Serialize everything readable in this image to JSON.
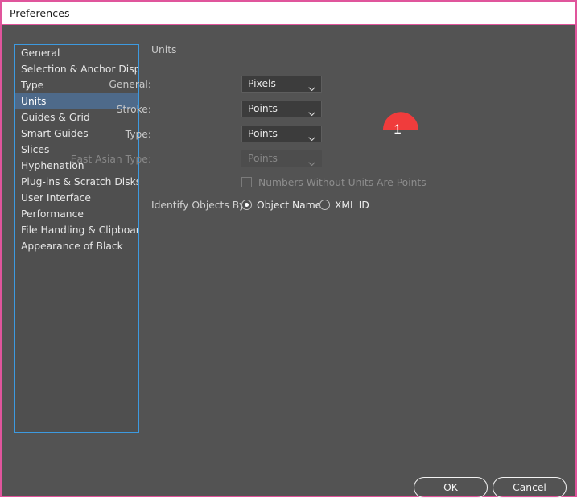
{
  "window": {
    "title": "Preferences",
    "border_color": "#e0559c",
    "background": "#535353"
  },
  "sidebar": {
    "accent_color": "#3d9ae0",
    "selected": "Units",
    "items": [
      {
        "label": "General"
      },
      {
        "label": "Selection & Anchor Display"
      },
      {
        "label": "Type"
      },
      {
        "label": "Units"
      },
      {
        "label": "Guides & Grid"
      },
      {
        "label": "Smart Guides"
      },
      {
        "label": "Slices"
      },
      {
        "label": "Hyphenation"
      },
      {
        "label": "Plug-ins & Scratch Disks"
      },
      {
        "label": "User Interface"
      },
      {
        "label": "Performance"
      },
      {
        "label": "File Handling & Clipboard"
      },
      {
        "label": "Appearance of Black"
      }
    ]
  },
  "panel": {
    "section_title": "Units",
    "fields": [
      {
        "label": "General:",
        "value": "Pixels",
        "disabled": false
      },
      {
        "label": "Stroke:",
        "value": "Points",
        "disabled": false
      },
      {
        "label": "Type:",
        "value": "Points",
        "disabled": false
      },
      {
        "label": "East Asian Type:",
        "value": "Points",
        "disabled": true
      }
    ],
    "checkbox": {
      "label": "Numbers Without Units Are Points",
      "checked": false,
      "disabled": true
    },
    "identify": {
      "label": "Identify Objects By:",
      "options": [
        {
          "label": "Object Name",
          "selected": true
        },
        {
          "label": "XML ID",
          "selected": false
        }
      ]
    }
  },
  "callout": {
    "number": "1",
    "color": "#f03c3c"
  },
  "footer": {
    "ok_label": "OK",
    "cancel_label": "Cancel"
  }
}
